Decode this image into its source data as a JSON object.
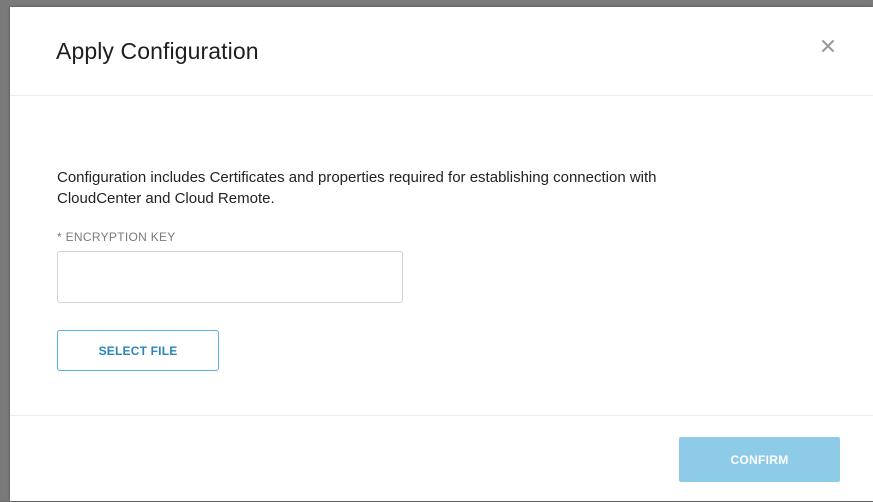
{
  "modal": {
    "title": "Apply Configuration",
    "close_icon": "close-icon",
    "description": "Configuration includes Certificates and properties required for establishing connection with CloudCenter and Cloud Remote.",
    "encryption_key": {
      "label": "* ENCRYPTION KEY",
      "value": "",
      "placeholder": ""
    },
    "select_file_label": "SELECT FILE",
    "confirm_label": "CONFIRM"
  },
  "colors": {
    "accent": "#2a85b8",
    "accent_border": "#5ab0d8",
    "confirm_disabled_bg": "#8ecbe8"
  }
}
